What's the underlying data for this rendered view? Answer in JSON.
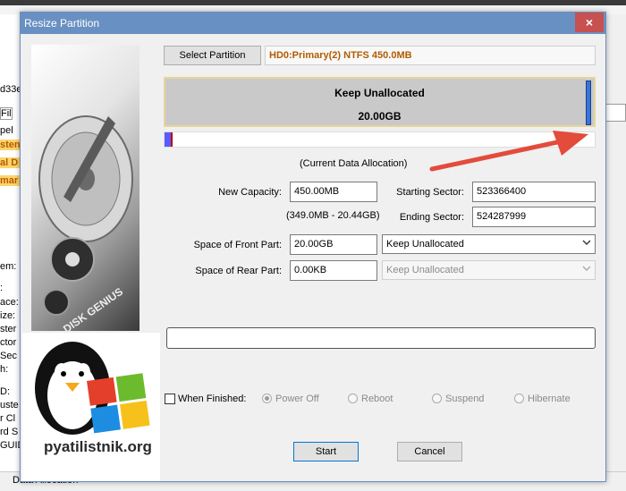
{
  "background": {
    "left_fragments": [
      "d33e",
      "Fil",
      "pel",
      "sten",
      "al D",
      "mar",
      "em:",
      ":",
      "ace:",
      "ize:",
      "ster",
      "ctor",
      "Sec",
      "h:",
      "D:",
      "uste",
      "r Cl",
      "rd S",
      "GUID"
    ],
    "bottom_text": "Data Allocation"
  },
  "dialog": {
    "title": "Resize Partition",
    "close_glyph": "×",
    "select_partition_label": "Select Partition",
    "partition_name": "HD0:Primary(2) NTFS 450.0MB",
    "bar": {
      "name": "Keep Unallocated",
      "size": "20.00GB",
      "slice_color": "#3a74d8"
    },
    "current_allocation_label": "(Current Data Allocation)",
    "new_capacity": {
      "label": "New Capacity:",
      "value": "450.00MB",
      "range": "(349.0MB - 20.44GB)"
    },
    "starting_sector": {
      "label": "Starting Sector:",
      "value": "523366400"
    },
    "ending_sector": {
      "label": "Ending Sector:",
      "value": "524287999"
    },
    "front_part": {
      "label": "Space of Front Part:",
      "value": "20.00GB",
      "option": "Keep Unallocated"
    },
    "rear_part": {
      "label": "Space of Rear Part:",
      "value": "0.00KB",
      "option": "Keep Unallocated"
    },
    "when_finished": {
      "label": "When Finished:",
      "options": [
        "Power Off",
        "Reboot",
        "Suspend",
        "Hibernate"
      ],
      "selected": "Power Off"
    },
    "start_label": "Start",
    "cancel_label": "Cancel",
    "side_brand": "DISK GENIUS",
    "watermark": "pyatilistnik.org"
  },
  "colors": {
    "titlebar": "#6990c2",
    "close": "#c75050",
    "partition_name": "#b25c00",
    "annotation_arrow": "#e34b3b"
  }
}
